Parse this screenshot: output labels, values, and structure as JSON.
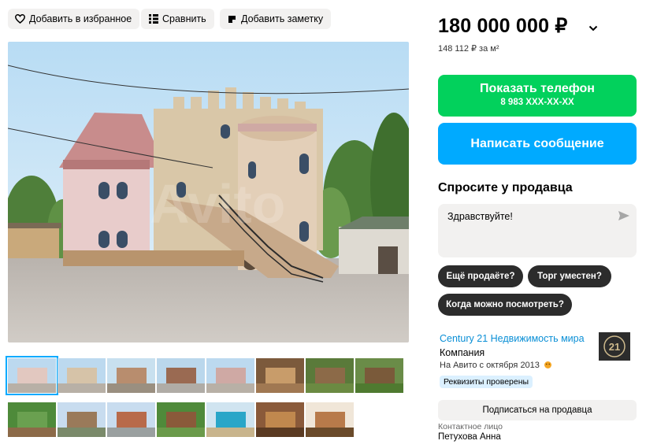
{
  "toolbar": {
    "favorite_label": "Добавить в избранное",
    "compare_label": "Сравнить",
    "note_label": "Добавить заметку"
  },
  "listing": {
    "price": "180 000 000 ₽",
    "price_per_m2": "148 112 ₽ за м²"
  },
  "actions": {
    "show_phone_label": "Показать телефон",
    "phone_masked": "8 983 XXX-XX-XX",
    "write_message_label": "Написать сообщение"
  },
  "ask_seller": {
    "title": "Спросите у продавца",
    "message": "Здравствуйте!",
    "quick_questions": [
      "Ещё продаёте?",
      "Торг уместен?",
      "Когда можно посмотреть?"
    ]
  },
  "seller": {
    "name": "Century 21 Недвижимость мира",
    "type": "Компания",
    "since": "На Авито с октября 2013",
    "verified": "Реквизиты проверены",
    "logo_text": "21",
    "subscribe_label": "Подписаться на продавца",
    "contact_label": "Контактное лицо",
    "contact_name": "Петухова Анна"
  },
  "photos": {
    "watermark": "Avito",
    "thumbnail_count": 15,
    "selected_index": 0
  },
  "colors": {
    "green": "#02d15c",
    "blue": "#00aaff",
    "chip": "#2c2c2c",
    "link": "#0a8fd6",
    "gray_bg": "#f2f1f0"
  }
}
